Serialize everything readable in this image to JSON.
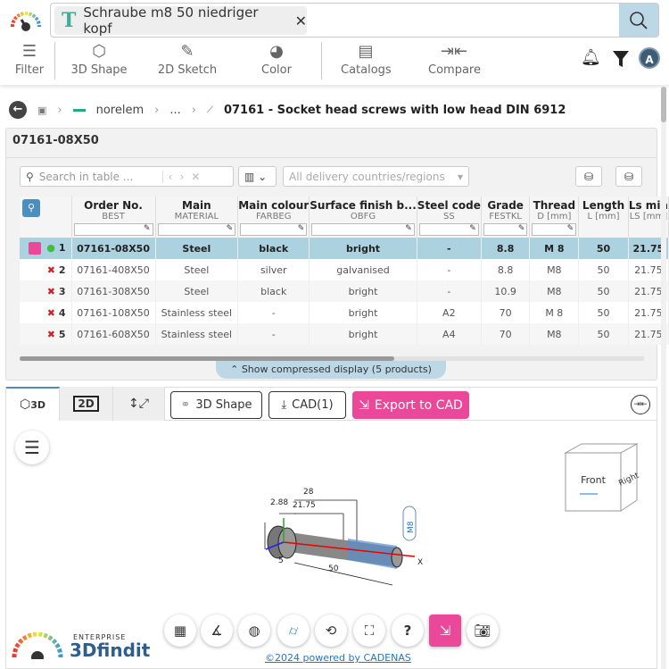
{
  "search": {
    "query": "Schraube m8 50 niedriger kopf",
    "clear_icon": "✕",
    "chip_icon": "T"
  },
  "toolbar": {
    "filter": "Filter",
    "shape3d": "3D Shape",
    "sketch2d": "2D Sketch",
    "color": "Color",
    "catalogs": "Catalogs",
    "compare": "Compare",
    "avatar": "A"
  },
  "breadcrumb": {
    "items": [
      "norelem",
      "...",
      "07161 - Socket head screws with low head DIN 6912"
    ]
  },
  "panel": {
    "title": "07161-08X50",
    "table_search_placeholder": "Search in table ...",
    "countries_placeholder": "All delivery countries/regions",
    "compressed_label": "Show compressed display (5 products)"
  },
  "table": {
    "columns": [
      {
        "title": "Order No.",
        "sub": "BEST"
      },
      {
        "title": "Main",
        "sub": "MATERIAL"
      },
      {
        "title": "Main colour",
        "sub": "FARBEG"
      },
      {
        "title": "Surface finish b...",
        "sub": "OBFG"
      },
      {
        "title": "Steel code",
        "sub": "SS"
      },
      {
        "title": "Grade",
        "sub": "FESTKL"
      },
      {
        "title": "Thread",
        "sub": "D [mm]"
      },
      {
        "title": "Length",
        "sub": "L [mm]"
      },
      {
        "title": "Ls min",
        "sub": "LS [mm]"
      }
    ],
    "rows": [
      {
        "idx": "1",
        "cells": [
          "07161-08X50",
          "Steel",
          "black",
          "bright",
          "-",
          "8.8",
          "M 8",
          "50",
          "21.75"
        ]
      },
      {
        "idx": "2",
        "cells": [
          "07161-408X50",
          "Steel",
          "silver",
          "galvanised",
          "-",
          "8.8",
          "M8",
          "50",
          "21.75"
        ]
      },
      {
        "idx": "3",
        "cells": [
          "07161-308X50",
          "Steel",
          "black",
          "bright",
          "-",
          "10.9",
          "M8",
          "50",
          "21.75"
        ]
      },
      {
        "idx": "4",
        "cells": [
          "07161-108X50",
          "Stainless steel",
          "-",
          "bright",
          "A2",
          "70",
          "M 8",
          "50",
          "21.75"
        ]
      },
      {
        "idx": "5",
        "cells": [
          "07161-608X50",
          "Stainless steel",
          "-",
          "bright",
          "A4",
          "70",
          "M8",
          "50",
          "21.75"
        ]
      }
    ]
  },
  "viewer": {
    "tab_3d": "3D",
    "tab_2d": "2D",
    "btn_shape": "3D Shape",
    "btn_cad": "CAD(1)",
    "btn_export": "Export to CAD",
    "cube_front": "Front",
    "cube_right": "Right",
    "dims": {
      "d28": "28",
      "d2185": "21.75",
      "d288": "2.88",
      "d5": "5",
      "d50": "50",
      "thread": "M8",
      "axis_x": "X"
    }
  },
  "footer": {
    "brand_small": "ENTERPRISE",
    "brand": "3Dfindit",
    "powered": "©2024 powered by CADENAS"
  },
  "colors": {
    "accent": "#ec4899",
    "selected_row": "#acd2e0",
    "search_button": "#bcd8e6"
  }
}
